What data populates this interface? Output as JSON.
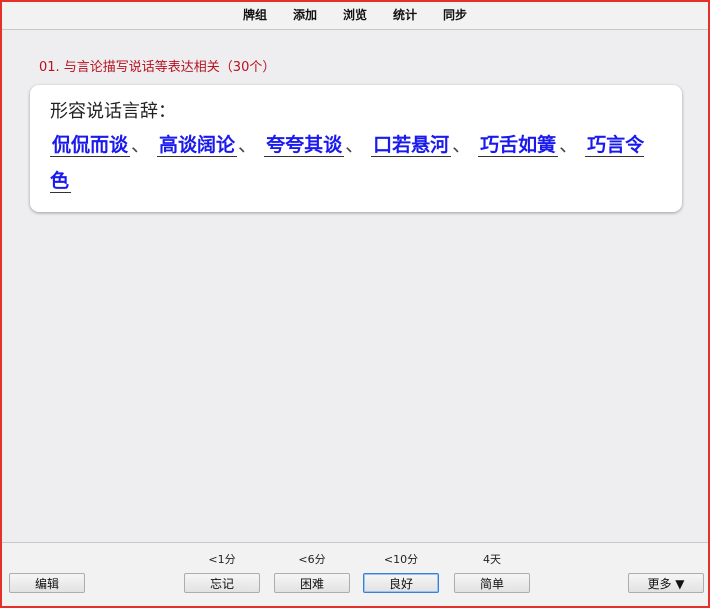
{
  "menu": {
    "decks": "牌组",
    "add": "添加",
    "browse": "浏览",
    "stats": "统计",
    "sync": "同步"
  },
  "deck_title": "01. 与言论描写说话等表达相关（30个）",
  "card": {
    "prompt": "形容说话言辞：",
    "answers": [
      "侃侃而谈",
      "高谈阔论",
      "夸夸其谈",
      "口若悬河",
      "巧舌如簧",
      "巧言令色"
    ],
    "separator": "、"
  },
  "bottom": {
    "edit": "编辑",
    "more": "更多 ▼",
    "ease": [
      {
        "label": "忘记",
        "interval": "<1分"
      },
      {
        "label": "困难",
        "interval": "<6分"
      },
      {
        "label": "良好",
        "interval": "<10分"
      },
      {
        "label": "简单",
        "interval": "4天"
      }
    ]
  }
}
